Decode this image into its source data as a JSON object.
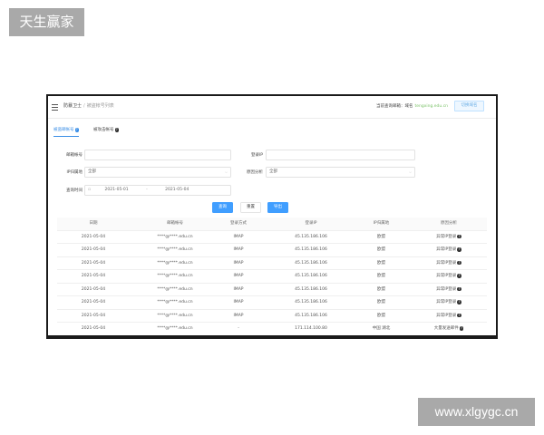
{
  "watermark": {
    "top": "天生赢家",
    "bottom": "www.xlgygc.cn"
  },
  "topbar": {
    "breadcrumb_root": "防暴卫士",
    "breadcrumb_sep": "/",
    "breadcrumb_current": "被盗帐号列表",
    "account_label": "当前查询邮箱：域名",
    "account_value": "tengxing.edu.cn",
    "switch_button": "切换域名"
  },
  "tabs": [
    {
      "label": "被盗邮帐号",
      "active": true
    },
    {
      "label": "被攻击帐号",
      "active": false
    }
  ],
  "filters": {
    "mailbox_label": "邮箱帐号",
    "mailbox_value": "",
    "ip_label": "登录IP",
    "ip_value": "",
    "ip_region_label": "IP归属地",
    "ip_region_value": "全部",
    "analysis_label": "原因分析",
    "analysis_value": "全部",
    "time_label": "查询时间",
    "date_start": "2021-05-01",
    "date_sep": "-",
    "date_end": "2021-05-04"
  },
  "buttons": {
    "query": "查询",
    "reset": "重置",
    "export": "导出"
  },
  "table": {
    "headers": [
      "日期",
      "邮箱帐号",
      "登录方式",
      "登录IP",
      "IP归属地",
      "原因分析"
    ],
    "rows": [
      [
        "2021-05-04",
        "****@****.edu.cn",
        "IMAP",
        "45.135.186.106",
        "欧盟",
        "异常IP登录"
      ],
      [
        "2021-05-04",
        "****@****.edu.cn",
        "IMAP",
        "45.135.186.106",
        "欧盟",
        "异常IP登录"
      ],
      [
        "2021-05-04",
        "****@****.edu.cn",
        "IMAP",
        "45.135.186.106",
        "欧盟",
        "异常IP登录"
      ],
      [
        "2021-05-04",
        "****@****.edu.cn",
        "IMAP",
        "45.135.186.106",
        "欧盟",
        "异常IP登录"
      ],
      [
        "2021-05-04",
        "****@****.edu.cn",
        "IMAP",
        "45.135.186.106",
        "欧盟",
        "异常IP登录"
      ],
      [
        "2021-05-04",
        "****@****.edu.cn",
        "IMAP",
        "45.135.186.106",
        "欧盟",
        "异常IP登录"
      ],
      [
        "2021-05-04",
        "****@****.edu.cn",
        "IMAP",
        "45.135.186.106",
        "欧盟",
        "异常IP登录"
      ],
      [
        "2021-05-04",
        "****@****.edu.cn",
        "-",
        "171.114.100.80",
        "中国 湖北",
        "大量发送邮件"
      ]
    ]
  }
}
